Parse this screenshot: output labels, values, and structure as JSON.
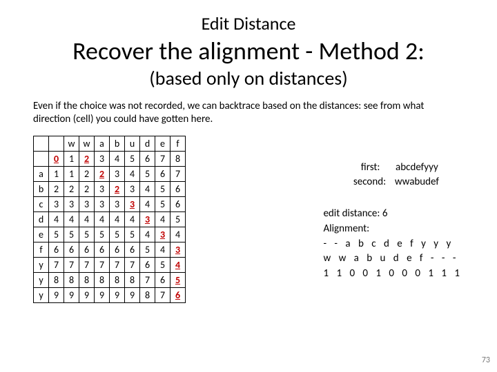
{
  "header": {
    "topic": "Edit Distance",
    "title": "Recover the alignment - Method 2:",
    "subtitle": "(based only on distances)"
  },
  "paragraph": "Even if the choice was not recorded, we can backtrace based on the distances: see from what direction (cell) you could have gotten here.",
  "table": {
    "col_labels": [
      "",
      "",
      "w",
      "w",
      "a",
      "b",
      "u",
      "d",
      "e",
      "f"
    ],
    "row_labels": [
      "",
      "a",
      "b",
      "c",
      "d",
      "e",
      "f",
      "y",
      "y",
      "y"
    ],
    "cells": [
      [
        "0",
        "1",
        "2",
        "3",
        "4",
        "5",
        "6",
        "7",
        "8"
      ],
      [
        "1",
        "1",
        "2",
        "2",
        "3",
        "4",
        "5",
        "6",
        "7"
      ],
      [
        "2",
        "2",
        "2",
        "3",
        "2",
        "3",
        "4",
        "5",
        "6"
      ],
      [
        "3",
        "3",
        "3",
        "3",
        "3",
        "3",
        "4",
        "5",
        "6"
      ],
      [
        "4",
        "4",
        "4",
        "4",
        "4",
        "4",
        "3",
        "4",
        "5"
      ],
      [
        "5",
        "5",
        "5",
        "5",
        "5",
        "5",
        "4",
        "3",
        "4"
      ],
      [
        "6",
        "6",
        "6",
        "6",
        "6",
        "6",
        "5",
        "4",
        "3"
      ],
      [
        "7",
        "7",
        "7",
        "7",
        "7",
        "7",
        "6",
        "5",
        "4"
      ],
      [
        "8",
        "8",
        "8",
        "8",
        "8",
        "8",
        "7",
        "6",
        "5"
      ],
      [
        "9",
        "9",
        "9",
        "9",
        "9",
        "9",
        "8",
        "7",
        "6"
      ]
    ],
    "backtrace": [
      [
        0,
        0
      ],
      [
        0,
        2
      ],
      [
        1,
        3
      ],
      [
        2,
        4
      ],
      [
        3,
        5
      ],
      [
        4,
        6
      ],
      [
        5,
        7
      ],
      [
        6,
        8
      ],
      [
        7,
        8
      ],
      [
        8,
        8
      ],
      [
        9,
        8
      ]
    ]
  },
  "right": {
    "first_label": "first:",
    "first_value": "abcdefyyy",
    "second_label": "second:",
    "second_value": "wwabudef",
    "ed_label": "edit distance:",
    "ed_value": "6",
    "align_label": "Alignment:",
    "align_row1": "- - a b c d e f y y y",
    "align_row2": "w w a b u d e f - - -",
    "align_row3": "1 1 0 0 1 0 0 0 1 1 1"
  },
  "page_number": "73"
}
